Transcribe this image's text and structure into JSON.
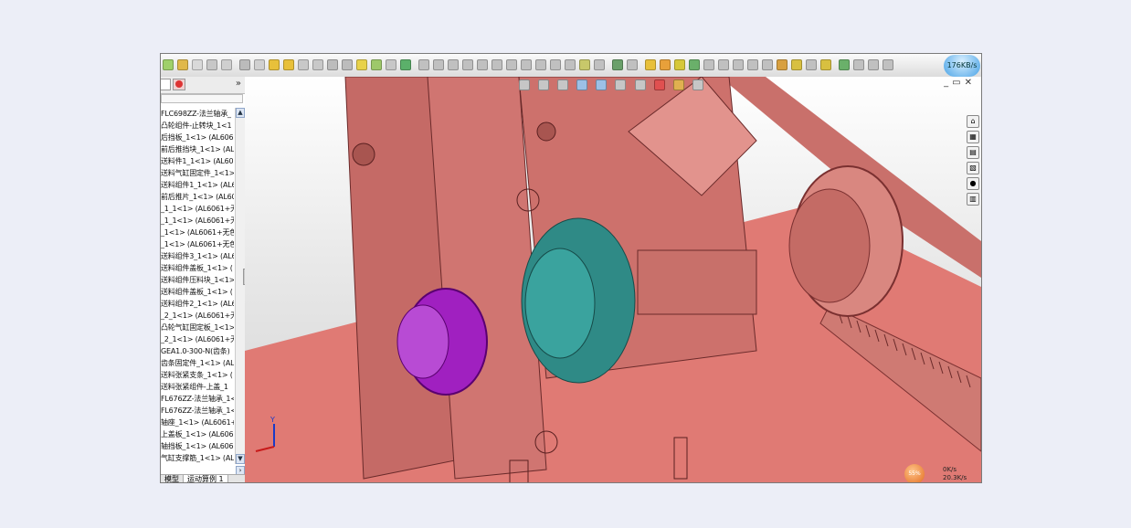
{
  "network": {
    "speed": "176KB/s"
  },
  "panel": {
    "expand": "»",
    "tree_items": [
      "FLC698ZZ-法兰轴承_",
      "凸轮组件-止转块_1<1",
      "后挡板_1<1> (AL6061",
      "前后推挡块_1<1> (AL",
      "送料件1_1<1> (AL606",
      "送料气缸固定件_1<1>",
      "送料组件1_1<1> (AL6",
      "前后推片_1<1> (AL60",
      "_1_1<1> (AL6061+无",
      "_1_1<1> (AL6061+无",
      "_1<1> (AL6061+无色",
      "_1<1> (AL6061+无色",
      "送料组件3_1<1> (AL6",
      "送料组件盖板_1<1> (",
      "送料组件压料块_1<1>",
      "送料组件盖板_1<1> (",
      "送料组件2_1<1> (AL6",
      "_2_1<1> (AL6061+无",
      "凸轮气缸固定板_1<1>",
      "_2_1<1> (AL6061+无",
      "GEA1.0-300-N(齿条)",
      "齿条固定件_1<1> (AL",
      "送料张紧支条_1<1> (",
      "送料张紧组件-上盖_1",
      "FL676ZZ-法兰轴承_1<",
      "FL676ZZ-法兰轴承_1<",
      "轴座_1<1> (AL6061+无",
      "上盖板_1<1> (AL6061",
      "轴挡板_1<1> (AL6061",
      "气缸支撑筋_1<1> (AL"
    ]
  },
  "bottom_tabs": [
    "模型",
    "运动算例 1"
  ],
  "speed_widget": {
    "percent": "55%",
    "up": "0K/s",
    "down": "20.3K/s"
  },
  "axes": {
    "y": "Y"
  },
  "colors": {
    "part_base": "#c86a66",
    "part_light": "#e79a94",
    "cam": "#a020c0",
    "flange": "#2f8a86",
    "gear": "#d07a73"
  }
}
